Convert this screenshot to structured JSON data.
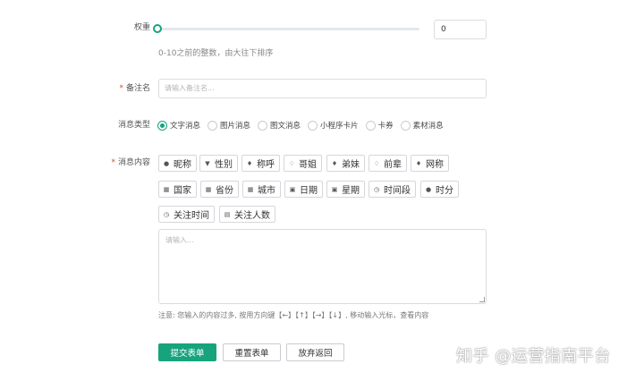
{
  "weight": {
    "label": "权重",
    "value": "0",
    "slider_level": 0,
    "hint": "0-10之前的整数，由大往下排序"
  },
  "remark": {
    "label": "备注名",
    "required_mark": "*",
    "placeholder": "请输入备注名..."
  },
  "message_type": {
    "label": "消息类型",
    "options": [
      "文字消息",
      "图片消息",
      "图文消息",
      "小程序卡片",
      "卡券",
      "素材消息"
    ],
    "selected": "文字消息"
  },
  "message_content": {
    "label": "消息内容",
    "required_mark": "*",
    "tags": [
      {
        "label": "昵称",
        "icon": "person-icon"
      },
      {
        "label": "性别",
        "icon": "gender-icon"
      },
      {
        "label": "称呼",
        "icon": "male-icon"
      },
      {
        "label": "哥姐",
        "icon": "female-icon"
      },
      {
        "label": "弟妹",
        "icon": "male-icon"
      },
      {
        "label": "前辈",
        "icon": "female-icon"
      },
      {
        "label": "网称",
        "icon": "male-icon"
      },
      {
        "label": "国家",
        "icon": "map-icon"
      },
      {
        "label": "省份",
        "icon": "map-icon"
      },
      {
        "label": "城市",
        "icon": "map-icon"
      },
      {
        "label": "日期",
        "icon": "calendar-icon"
      },
      {
        "label": "星期",
        "icon": "calendar-icon"
      },
      {
        "label": "时间段",
        "icon": "clock-icon"
      },
      {
        "label": "时分",
        "icon": "clock-filled-icon"
      },
      {
        "label": "关注时间",
        "icon": "clock-icon"
      },
      {
        "label": "关注人数",
        "icon": "list-icon"
      }
    ],
    "placeholder": "请输入...",
    "note": "注意: 您输入的内容过多, 按用方向键【←】【↑】【→】【↓】, 移动输入光标，查看内容"
  },
  "actions": {
    "submit": "提交表单",
    "reset": "重置表单",
    "cancel": "放弃返回"
  },
  "watermark": "知乎 @运营指南平台",
  "colors": {
    "accent": "#16a37d",
    "required": "#e0452b"
  }
}
